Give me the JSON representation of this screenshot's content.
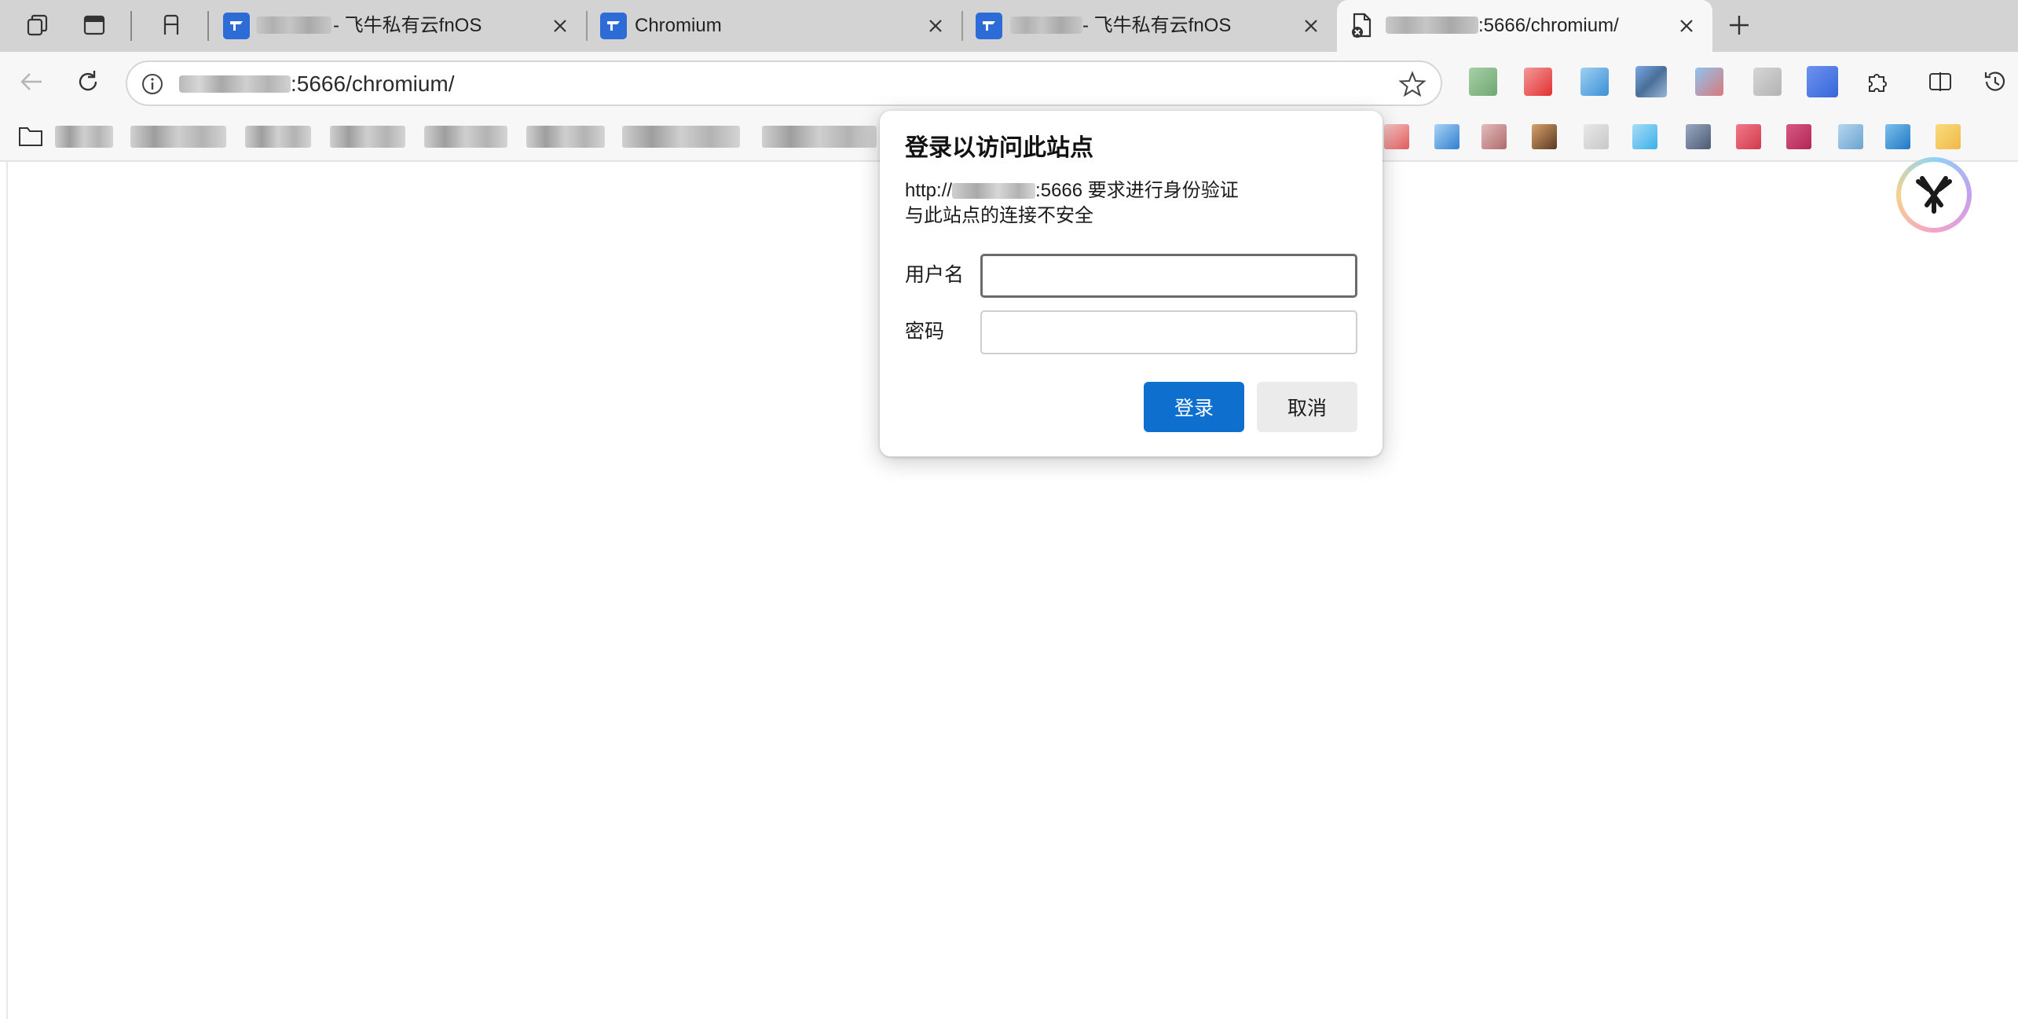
{
  "colors": {
    "tabstrip_bg": "#d3d3d3",
    "toolbar_bg": "#f7f7f7",
    "accent": "#0f6fcf",
    "fnos_favicon": "#2d6bd6"
  },
  "tabs": [
    {
      "title": "- 飞牛私有云fnOS",
      "favicon": "fnos-icon",
      "active": false
    },
    {
      "title": "Chromium",
      "favicon": "fnos-icon",
      "active": false
    },
    {
      "title": "- 飞牛私有云fnOS",
      "favicon": "fnos-icon",
      "active": false
    },
    {
      "title": ":5666/chromium/",
      "favicon": "page-error-icon",
      "active": true
    }
  ],
  "address_bar": {
    "url_suffix": ":5666/chromium/"
  },
  "auth_dialog": {
    "title": "登录以访问此站点",
    "line1_prefix": "http://",
    "line1_suffix": ":5666 要求进行身份验证",
    "line2": "与此站点的连接不安全",
    "username_label": "用户名",
    "username_value": "",
    "password_label": "密码",
    "password_value": "",
    "login_button": "登录",
    "cancel_button": "取消"
  }
}
